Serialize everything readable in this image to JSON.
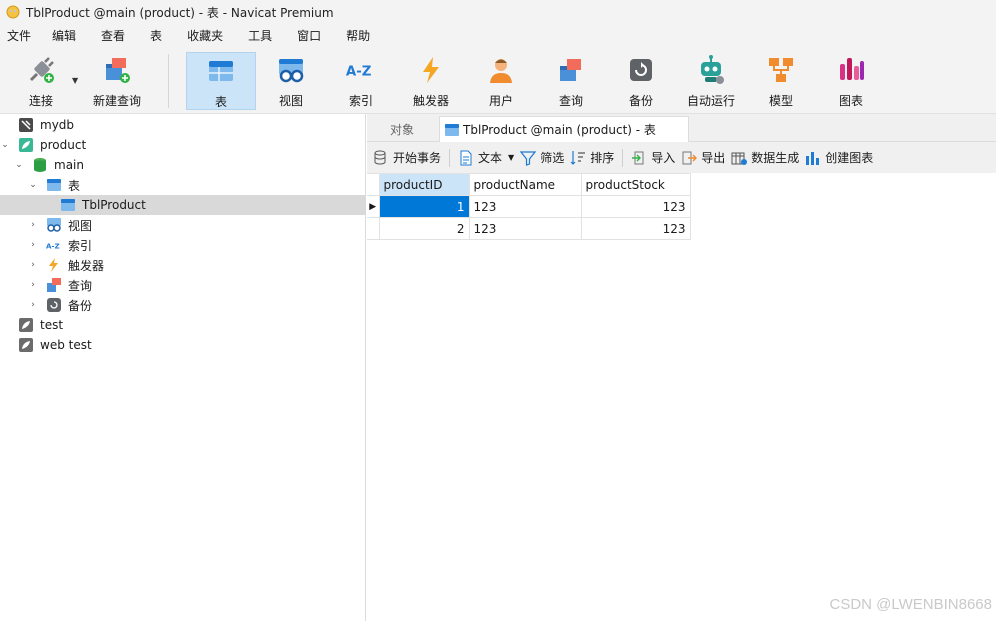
{
  "window": {
    "title": "TblProduct @main (product) - 表 - Navicat Premium"
  },
  "menu": [
    "文件",
    "编辑",
    "查看",
    "表",
    "收藏夹",
    "工具",
    "窗口",
    "帮助"
  ],
  "toolbar": {
    "connect": "连接",
    "new_query": "新建查询",
    "table": "表",
    "view": "视图",
    "index": "索引",
    "trigger": "触发器",
    "user": "用户",
    "query": "查询",
    "backup": "备份",
    "automation": "自动运行",
    "model": "模型",
    "chart": "图表"
  },
  "tree": {
    "mydb": "mydb",
    "product": "product",
    "main": "main",
    "tables": "表",
    "tblproduct": "TblProduct",
    "views": "视图",
    "indexes": "索引",
    "triggers": "触发器",
    "queries": "查询",
    "backups": "备份",
    "test": "test",
    "webtest": "web test"
  },
  "tabs": {
    "objects": "对象",
    "active": "TblProduct @main (product) - 表"
  },
  "subtoolbar": {
    "begin_tx": "开始事务",
    "text": "文本",
    "filter": "筛选",
    "sort": "排序",
    "import": "导入",
    "export": "导出",
    "data_gen": "数据生成",
    "create_chart": "创建图表"
  },
  "grid": {
    "columns": [
      "productID",
      "productName",
      "productStock"
    ],
    "rows": [
      [
        "1",
        "123",
        "123"
      ],
      [
        "2",
        "123",
        "123"
      ]
    ]
  },
  "watermark": "CSDN @LWENBIN8668",
  "colors": {
    "accent": "#0078d7",
    "selection": "#cce4f7"
  }
}
